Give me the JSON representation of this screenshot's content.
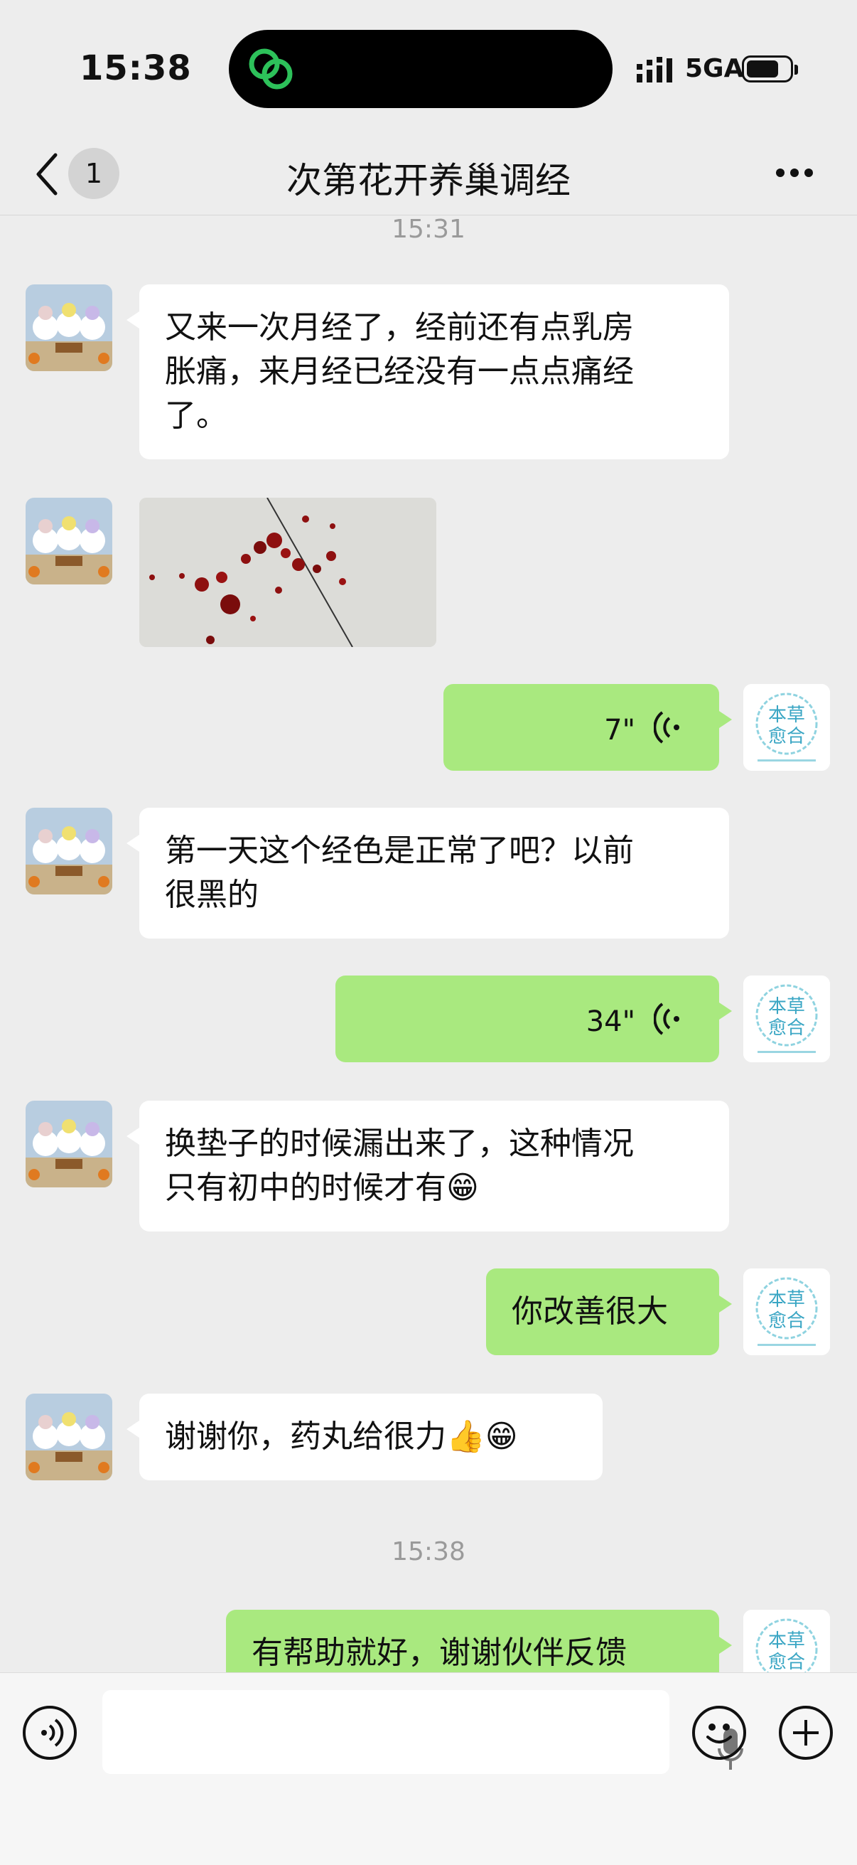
{
  "status_bar": {
    "time": "15:38",
    "network": "5GA"
  },
  "nav": {
    "back_badge": "1",
    "title": "次第花开养巢调经",
    "more_icon": "more-dots-icon"
  },
  "messages": [
    {
      "type": "timestamp",
      "text": "15:31"
    },
    {
      "type": "text",
      "side": "in",
      "text": "又来一次月经了，经前还有点乳房胀痛，来月经已经没有一点点痛经了。",
      "lines": [
        "又来一次月经了，经前还有点乳房",
        "胀痛，来月经已经没有一点点痛经",
        "了。"
      ]
    },
    {
      "type": "image",
      "side": "in",
      "description": "photo"
    },
    {
      "type": "voice",
      "side": "out",
      "duration": "7\""
    },
    {
      "type": "text",
      "side": "in",
      "lines": [
        "第一天这个经色是正常了吧？以前",
        "很黑的"
      ]
    },
    {
      "type": "voice",
      "side": "out",
      "duration": "34\""
    },
    {
      "type": "text",
      "side": "in",
      "lines": [
        "换垫子的时候漏出来了，这种情况",
        "只有初中的时候才有😁"
      ]
    },
    {
      "type": "text",
      "side": "out",
      "text": "你改善很大"
    },
    {
      "type": "text",
      "side": "in",
      "text": "谢谢你，药丸给很力👍😁"
    },
    {
      "type": "timestamp",
      "text": "15:38"
    },
    {
      "type": "text",
      "side": "out",
      "text": "有帮助就好，谢谢伙伴反馈"
    }
  ],
  "self_avatar": {
    "line1": "本草",
    "line2": "愈合"
  },
  "input_bar": {
    "voice_icon": "voice-mode-icon",
    "mic_icon": "mic-icon",
    "emoji_icon": "emoji-icon",
    "plus_icon": "plus-icon"
  },
  "colors": {
    "background": "#ededed",
    "outgoing": "#a9e97f",
    "incoming": "#ffffff"
  }
}
